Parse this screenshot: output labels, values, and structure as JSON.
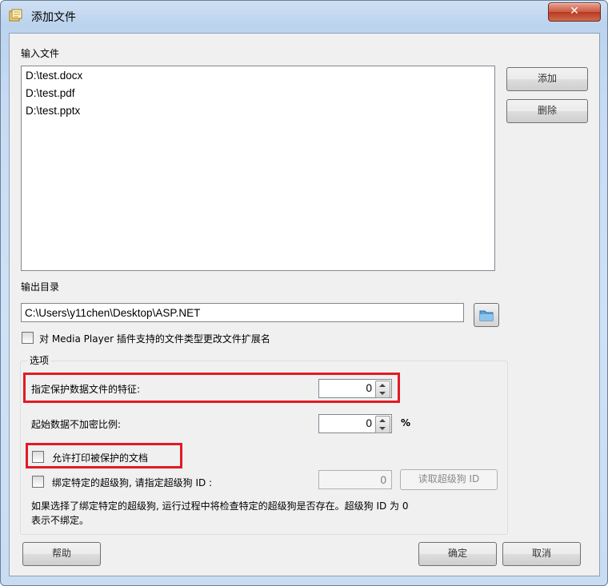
{
  "window": {
    "title": "添加文件",
    "close_label": "✕"
  },
  "input_files": {
    "label": "输入文件",
    "items": [
      "D:\\test.docx",
      "D:\\test.pdf",
      "D:\\test.pptx"
    ],
    "add_label": "添加",
    "delete_label": "删除"
  },
  "output": {
    "label": "输出目录",
    "path": "C:\\Users\\y11chen\\Desktop\\ASP.NET",
    "change_ext_label": "对 Media Player 插件支持的文件类型更改文件扩展名"
  },
  "options": {
    "title": "选项",
    "feature_label": "指定保护数据文件的特征:",
    "feature_value": "0",
    "unencrypted_label": "起始数据不加密比例:",
    "unencrypted_value": "0",
    "unencrypted_unit": "%",
    "allow_print_label": "允许打印被保护的文档",
    "bind_dongle_label": "绑定特定的超级狗, 请指定超级狗 ID :",
    "dongle_id_value": "0",
    "read_dongle_label": "读取超级狗 ID",
    "note_line1": "如果选择了绑定特定的超级狗, 运行过程中将检查特定的超级狗是否存在。超级狗 ID 为 0",
    "note_line2": "表示不绑定。"
  },
  "footer": {
    "help_label": "帮助",
    "ok_label": "确定",
    "cancel_label": "取消"
  },
  "colors": {
    "highlight": "#e01b24",
    "close_button": "#c95a43"
  }
}
